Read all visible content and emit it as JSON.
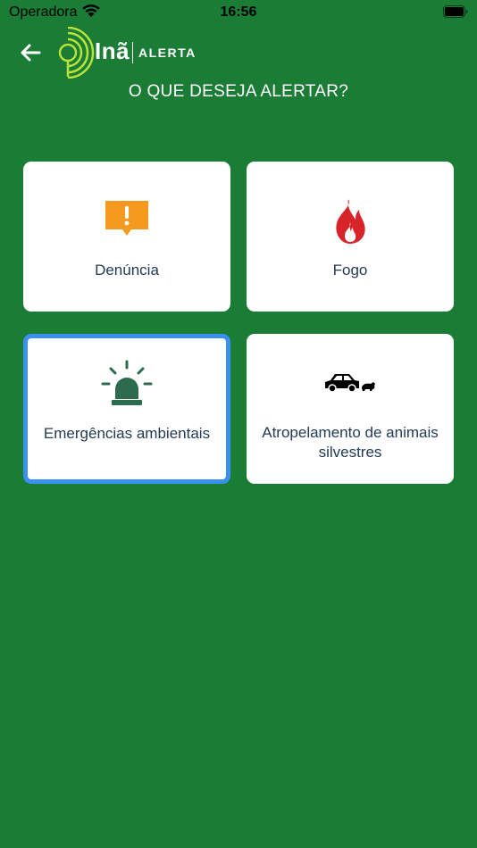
{
  "status_bar": {
    "carrier": "Operadora",
    "time": "16:56"
  },
  "header": {
    "logo_text": "Inã",
    "logo_subtitle": "ALERTA",
    "title": "O QUE DESEJA ALERTAR?"
  },
  "options": [
    {
      "label": "Denúncia",
      "icon": "alert-bubble-icon",
      "color": "#f59a1e"
    },
    {
      "label": "Fogo",
      "icon": "fire-icon",
      "color": "#d8232a"
    },
    {
      "label": "Emergências ambientais",
      "icon": "siren-icon",
      "color": "#2d6b4f",
      "selected": true
    },
    {
      "label": "Atropelamento de animais silvestres",
      "icon": "car-animal-icon",
      "color": "#000000"
    }
  ],
  "colors": {
    "background": "#1b7c36",
    "card": "#ffffff",
    "selected_border": "#3a8ff0",
    "label_text": "#233a56",
    "logo_accent": "#b6e23a"
  }
}
